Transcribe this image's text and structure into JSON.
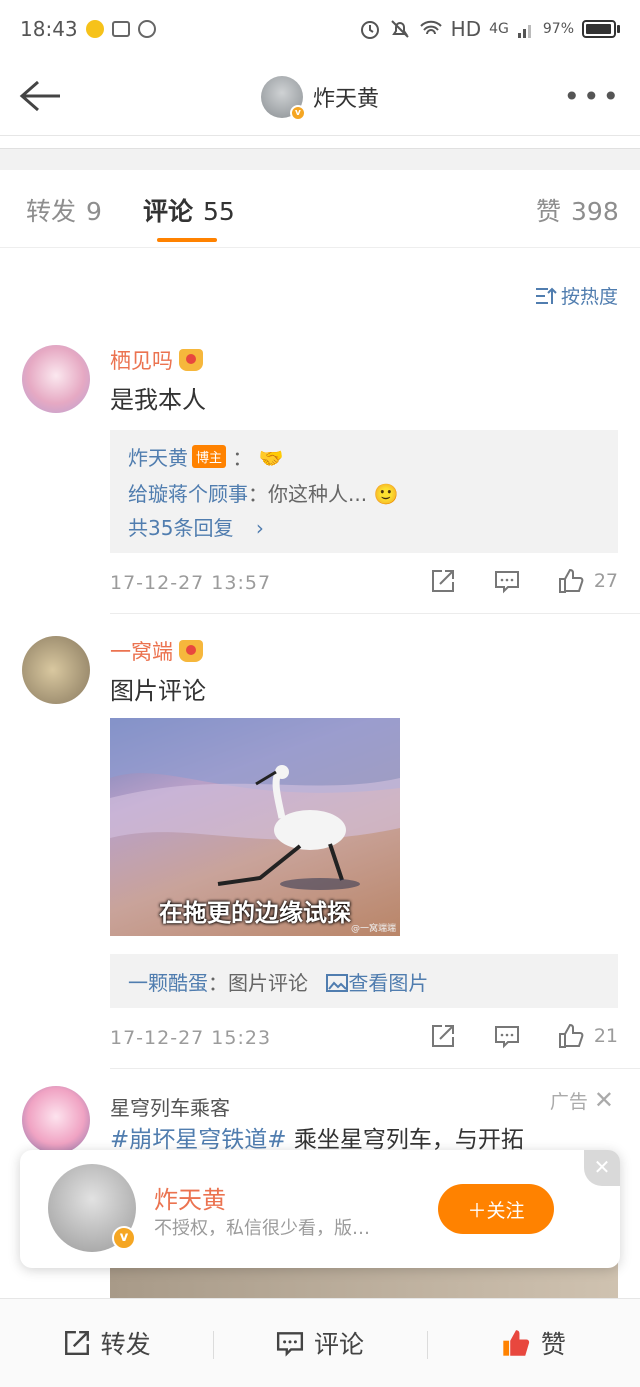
{
  "status_bar": {
    "time": "18:43",
    "network": "HD",
    "signal": "4G",
    "battery": "97%"
  },
  "nav": {
    "title": "炸天黄"
  },
  "tabs": [
    {
      "label": "转发",
      "count": "9"
    },
    {
      "label": "评论",
      "count": "55",
      "active": true
    },
    {
      "label": "赞",
      "count": "398"
    }
  ],
  "sort_label": "按热度",
  "comments": [
    {
      "user": "栖见吗",
      "text": "是我本人",
      "replies": {
        "host_name": "炸天黄",
        "host_tag": "博主",
        "host_sep": "：",
        "second_user": "给璇蒋个顾事",
        "second_text": "：你这种人...",
        "total": "共35条回复"
      },
      "time": "17-12-27 13:57",
      "likes": "27"
    },
    {
      "user": "一窝端",
      "text": "图片评论",
      "photo_caption": "在拖更的边缘试探",
      "photo_watermark": "@一窝端端",
      "reply_user": "一颗酷蛋",
      "reply_text": "：图片评论",
      "view_image": "查看图片",
      "time": "17-12-27 15:23",
      "likes": "21"
    }
  ],
  "ad": {
    "user": "星穹列车乘客",
    "tag": "广告",
    "topic": "#崩坏星穹铁道#",
    "text": " 乘坐星穹列车，与开拓"
  },
  "floating_card": {
    "name": "炸天黄",
    "desc": "不授权，私信很少看，版…",
    "follow": "关注"
  },
  "bottom_bar": {
    "repost": "转发",
    "comment": "评论",
    "like": "赞"
  },
  "colors": {
    "accent": "#ff8200",
    "link": "#507daf",
    "username": "#eb7350"
  }
}
